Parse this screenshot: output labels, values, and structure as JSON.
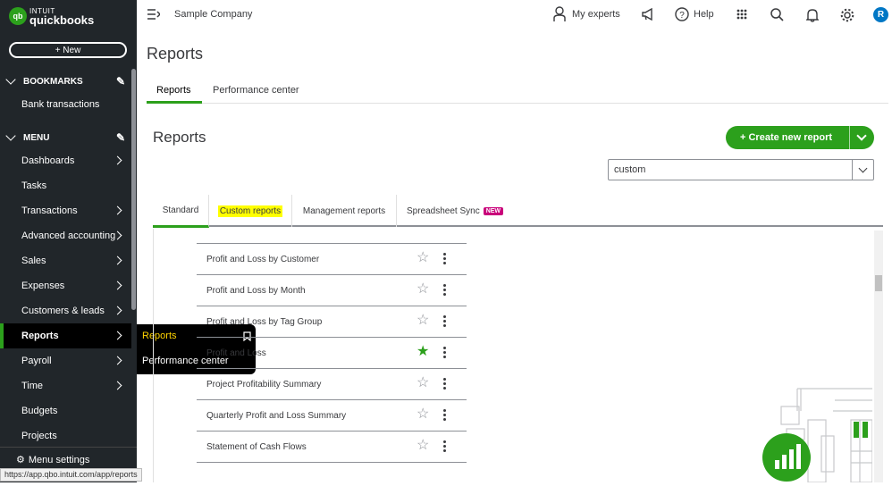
{
  "logo": {
    "line1": "INTUIT",
    "line2": "quickbooks",
    "badge": "qb"
  },
  "sidebar": {
    "new_label": "+ New",
    "bookmarks_label": "BOOKMARKS",
    "bookmark_items": [
      "Bank transactions"
    ],
    "menu_label": "MENU",
    "items": [
      {
        "label": "Dashboards",
        "arrow": true
      },
      {
        "label": "Tasks",
        "arrow": false
      },
      {
        "label": "Transactions",
        "arrow": true
      },
      {
        "label": "Advanced accounting",
        "arrow": true
      },
      {
        "label": "Sales",
        "arrow": true
      },
      {
        "label": "Expenses",
        "arrow": true
      },
      {
        "label": "Customers & leads",
        "arrow": true
      },
      {
        "label": "Reports",
        "arrow": true
      },
      {
        "label": "Payroll",
        "arrow": true
      },
      {
        "label": "Time",
        "arrow": true
      },
      {
        "label": "Budgets",
        "arrow": false
      },
      {
        "label": "Projects",
        "arrow": false
      }
    ],
    "menu_settings_label": "Menu settings",
    "status_url": "https://app.qbo.intuit.com/app/reports"
  },
  "flyout": {
    "items": [
      "Reports",
      "Performance center"
    ]
  },
  "topbar": {
    "company": "Sample Company",
    "my_experts": "My experts",
    "help": "Help",
    "avatar": "R"
  },
  "page": {
    "title": "Reports",
    "tabs": [
      "Reports",
      "Performance center"
    ],
    "heading": "Reports",
    "create_label": "+ Create new report",
    "search_value": "custom",
    "report_tabs": [
      "Standard",
      "Custom reports",
      "Management reports",
      "Spreadsheet Sync"
    ],
    "new_badge": "NEW"
  },
  "reports": [
    {
      "name": "Profit and Loss by Customer",
      "favorite": false
    },
    {
      "name": "Profit and Loss by Month",
      "favorite": false
    },
    {
      "name": "Profit and Loss by Tag Group",
      "favorite": false
    },
    {
      "name": "Profit and Loss",
      "favorite": true
    },
    {
      "name": "Project Profitability Summary",
      "favorite": false
    },
    {
      "name": "Quarterly Profit and Loss Summary",
      "favorite": false
    },
    {
      "name": "Statement of Cash Flows",
      "favorite": false
    }
  ],
  "colors": {
    "brand": "#2ca01c",
    "sidebar": "#21262a",
    "highlight": "#ffff00",
    "badge": "#c9007a"
  }
}
